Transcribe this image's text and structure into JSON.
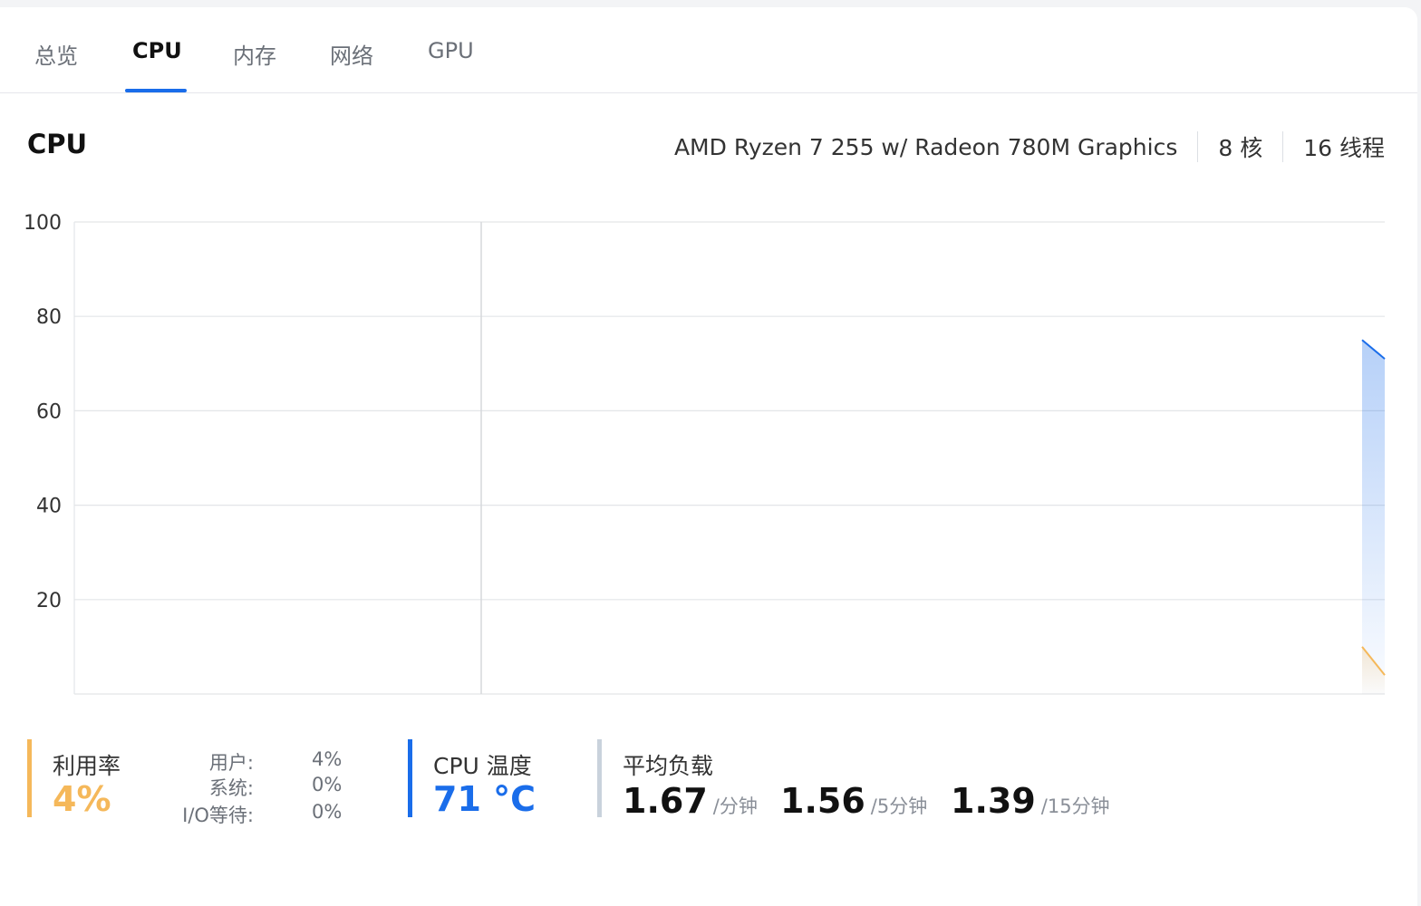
{
  "tabs": [
    {
      "label": "总览",
      "active": false
    },
    {
      "label": "CPU",
      "active": true
    },
    {
      "label": "内存",
      "active": false
    },
    {
      "label": "网络",
      "active": false
    },
    {
      "label": "GPU",
      "active": false
    }
  ],
  "header": {
    "title": "CPU",
    "model": "AMD Ryzen 7 255 w/ Radeon 780M Graphics",
    "cores": "8 核",
    "threads": "16 线程"
  },
  "chart_data": {
    "type": "area",
    "yticks": [
      100,
      80,
      60,
      40,
      20
    ],
    "ylim": [
      0,
      100
    ],
    "grid": true,
    "series": [
      {
        "color": "#1a6dea",
        "values": [
          75,
          71
        ]
      },
      {
        "color": "#f5b85a",
        "values": [
          10,
          4
        ]
      }
    ]
  },
  "colors": {
    "accent": "#1a6dea",
    "utilization": "#f5b85a",
    "load": "#c9d2dc"
  },
  "stats": {
    "utilization": {
      "label": "利用率",
      "value": "4%",
      "rows": [
        {
          "key": "用户:",
          "value": "4%"
        },
        {
          "key": "系统:",
          "value": "0%"
        },
        {
          "key": "I/O等待:",
          "value": "0%"
        }
      ]
    },
    "temperature": {
      "label": "CPU 温度",
      "value": "71 °C"
    },
    "load": {
      "label": "平均负载",
      "items": [
        {
          "value": "1.67",
          "unit": "/分钟"
        },
        {
          "value": "1.56",
          "unit": "/5分钟"
        },
        {
          "value": "1.39",
          "unit": "/15分钟"
        }
      ]
    }
  }
}
